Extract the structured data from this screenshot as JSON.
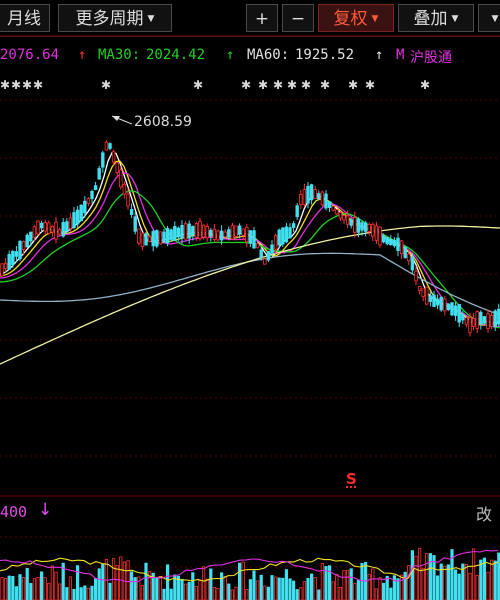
{
  "toolbar": {
    "period_label": "月线",
    "more_periods_label": "更多周期",
    "zoom_in_label": "+",
    "zoom_out_label": "−",
    "adjust_label": "复权",
    "overlay_label": "叠加"
  },
  "ma_bar": {
    "ma_value_1": "2076.64",
    "ma30_label": "MA30:",
    "ma30_value": "2024.42",
    "ma60_label": "MA60:",
    "ma60_value": "1925.52",
    "overlay_prefix": "M",
    "overlay_name": "沪股通"
  },
  "chart": {
    "peak_value": "2608.59",
    "signal_marker": "S"
  },
  "volume": {
    "value": "400",
    "right_text": "改"
  },
  "colors": {
    "up": "#ff3030",
    "down": "#40e0f0",
    "ma_white": "#ffffff",
    "ma_yellow": "#f0e020",
    "ma_magenta": "#e030e0",
    "ma_green": "#20d020",
    "ma_slate": "#8fb0c8",
    "ma_long": "#f0f0a0"
  }
}
